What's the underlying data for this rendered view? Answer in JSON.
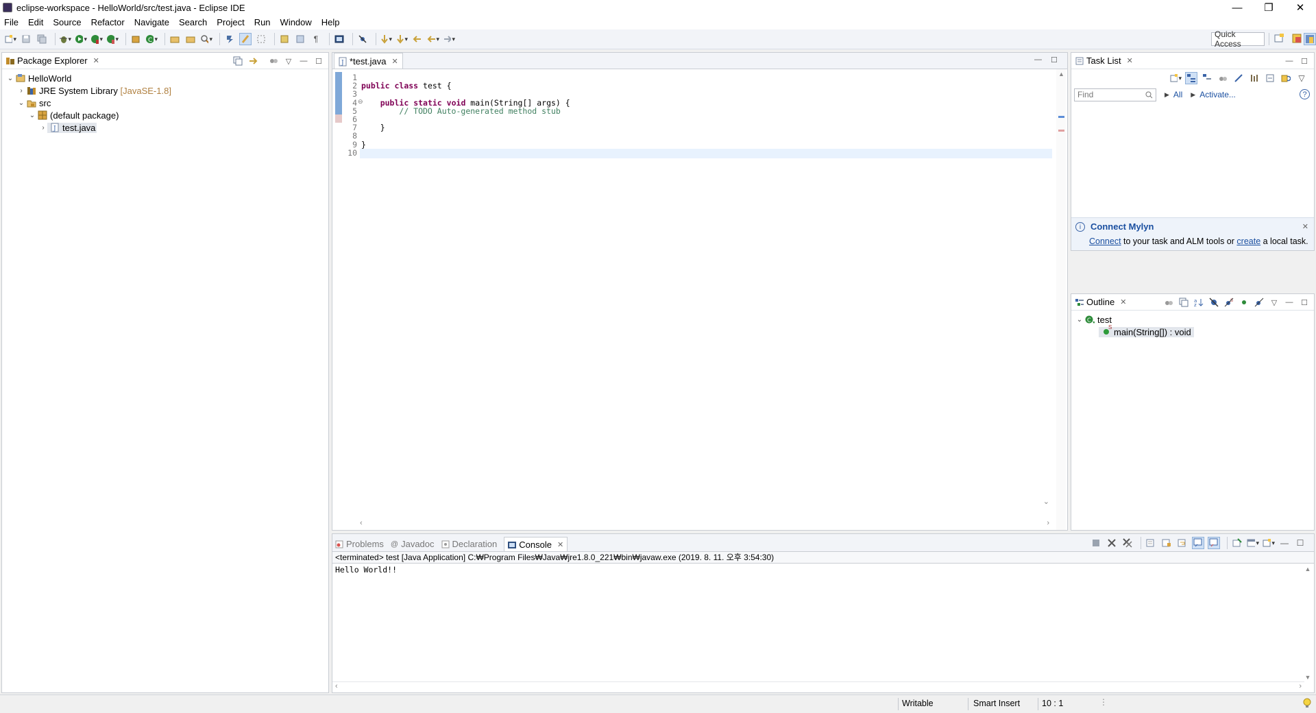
{
  "window": {
    "title": "eclipse-workspace - HelloWorld/src/test.java - Eclipse IDE",
    "controls": [
      "—",
      "❐",
      "✕"
    ]
  },
  "menu": [
    "File",
    "Edit",
    "Source",
    "Refactor",
    "Navigate",
    "Search",
    "Project",
    "Run",
    "Window",
    "Help"
  ],
  "toolbar": {
    "quick_access": "Quick Access"
  },
  "package_explorer": {
    "title": "Package Explorer",
    "close": "✕",
    "tree": [
      {
        "label": "HelloWorld",
        "extra": ""
      },
      {
        "label": "JRE System Library",
        "extra": "[JavaSE-1.8]"
      },
      {
        "label": "src",
        "extra": ""
      },
      {
        "label": "(default package)",
        "extra": ""
      },
      {
        "label": "test.java",
        "extra": ""
      }
    ]
  },
  "editor": {
    "tab_label": "*test.java",
    "close": "✕",
    "line_numbers": [
      "1",
      "2",
      "3",
      "4",
      "5",
      "6",
      "7",
      "8",
      "9",
      "10"
    ],
    "fold_marker": "⊖"
  },
  "task_list": {
    "title": "Task List",
    "close": "✕",
    "find_placeholder": "Find",
    "filter_all": "All",
    "filter_activate": "Activate...",
    "help": "?"
  },
  "mylyn": {
    "title": "Connect Mylyn",
    "connect_link": "Connect",
    "text_middle": " to your task and ALM tools or ",
    "create_link": "create",
    "text_end": " a local task.",
    "close": "✕"
  },
  "outline": {
    "title": "Outline",
    "close": "✕",
    "class_name": "test",
    "method": "main(String[]) : void",
    "method_modifier": "S"
  },
  "console": {
    "tabs": [
      "Problems",
      "Javadoc",
      "Declaration",
      "Console"
    ],
    "close": "✕",
    "status_line": "<terminated> test [Java Application] C:₩Program Files₩Java₩jre1.8.0_221₩bin₩javaw.exe (2019. 8. 11. 오후 3:54:30)",
    "output": "Hello World!!"
  },
  "statusbar": {
    "writable": "Writable",
    "insert_mode": "Smart Insert",
    "position": "10 : 1"
  },
  "colors": {
    "keyword": "#7f0055",
    "comment": "#3f7f5f",
    "link": "#1a4fa0",
    "current_line": "#e8f2fe"
  }
}
